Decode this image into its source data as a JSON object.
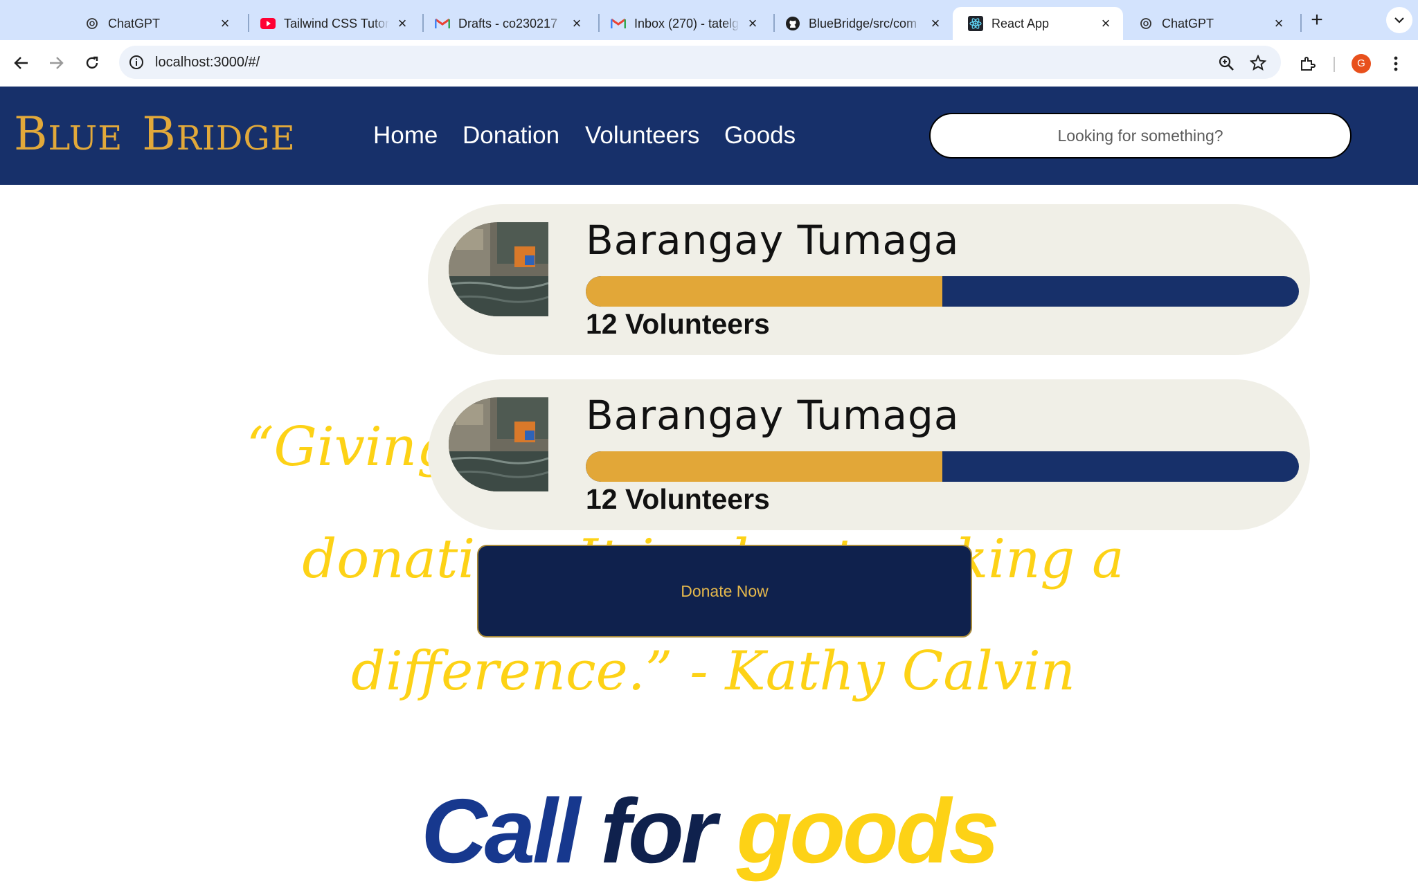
{
  "browser": {
    "tabs": [
      {
        "title": "ChatGPT",
        "icon": "chatgpt-icon",
        "active": false
      },
      {
        "title": "Tailwind CSS Tutorial",
        "icon": "youtube-icon",
        "active": false
      },
      {
        "title": "Drafts - co230217",
        "icon": "gmail-icon",
        "active": false
      },
      {
        "title": "Inbox (270) - tatelg",
        "icon": "gmail-icon",
        "active": false
      },
      {
        "title": "BlueBridge/src/com",
        "icon": "github-icon",
        "active": false
      },
      {
        "title": "React App",
        "icon": "react-icon",
        "active": true
      },
      {
        "title": "ChatGPT",
        "icon": "chatgpt-icon",
        "active": false
      }
    ],
    "url": "localhost:3000/#/",
    "profile_initial": "G",
    "colors": {
      "tabstrip": "#d3e3fd",
      "omnibox": "#edf2fa",
      "avatar": "#e8501c"
    }
  },
  "site": {
    "logo_parts": {
      "b1": "B",
      "lue": "LUE",
      "b2": "B",
      "ridge": "RIDGE"
    },
    "nav": [
      "Home",
      "Donation",
      "Volunteers",
      "Goods"
    ],
    "search_placeholder": "Looking for something?",
    "colors": {
      "navy": "#17306a",
      "gold": "#e2a738",
      "yellow": "#fdd216",
      "card": "#f0efe7"
    }
  },
  "campaigns": [
    {
      "title": "Barangay Tumaga",
      "volunteers_label": "12 Volunteers",
      "progress": 0.5
    },
    {
      "title": "Barangay Tumaga",
      "volunteers_label": "12 Volunteers",
      "progress": 0.5
    }
  ],
  "quote": "“Giving is not just about making a donation. It is about making a difference.” - Kathy Calvin",
  "donate_button": "Donate Now",
  "section_title": {
    "w1": "Call",
    "w2": "for",
    "w3": "goods"
  }
}
